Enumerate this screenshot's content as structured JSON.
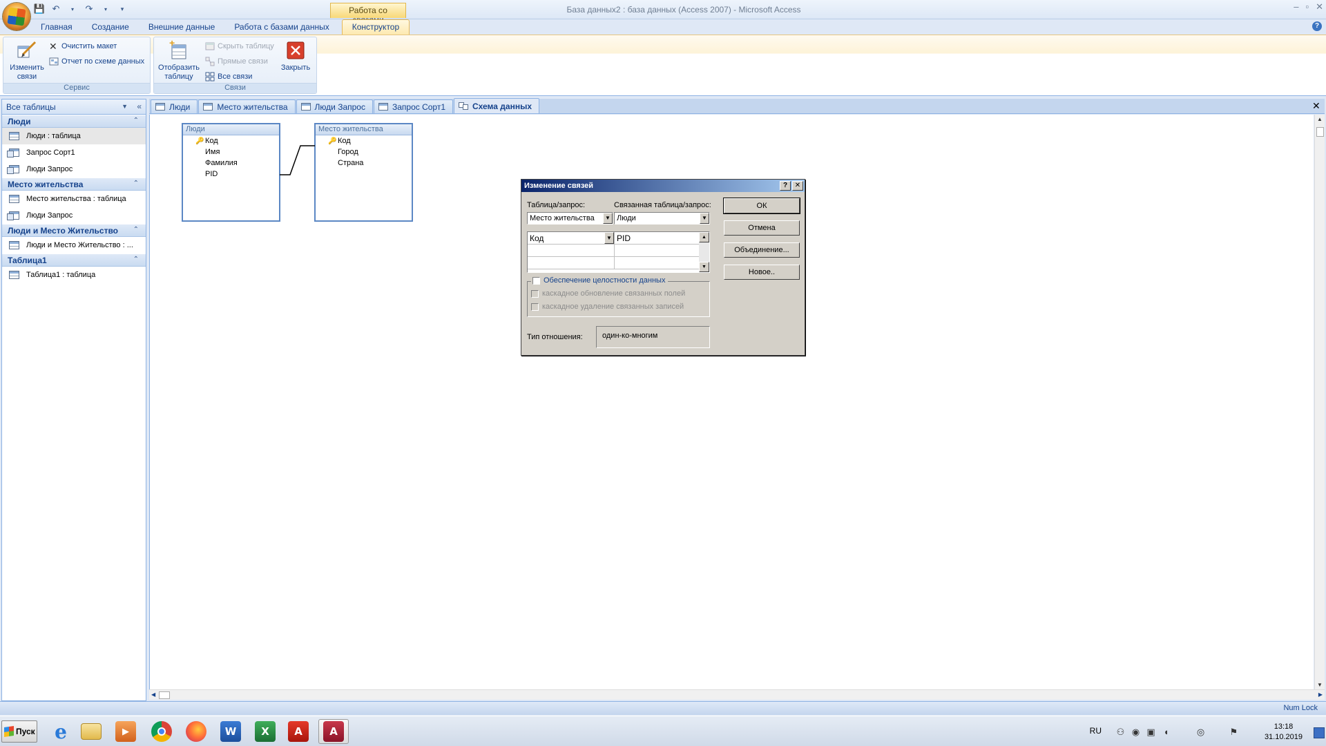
{
  "window": {
    "title": "База данных2 : база данных (Access 2007) - Microsoft Access",
    "context_tab_group": "Работа со связями"
  },
  "ribbon": {
    "tabs": [
      "Главная",
      "Создание",
      "Внешние данные",
      "Работа с базами данных",
      "Конструктор"
    ],
    "active_tab": "Конструктор",
    "groups": {
      "service": {
        "label": "Сервис",
        "edit_links": "Изменить связи",
        "clear_layout": "Очистить макет",
        "schema_report": "Отчет по схеме данных"
      },
      "links": {
        "label": "Связи",
        "show_table": "Отобразить таблицу",
        "hide_table": "Скрыть таблицу",
        "direct_links": "Прямые связи",
        "all_links": "Все связи",
        "close": "Закрыть"
      }
    }
  },
  "nav": {
    "header": "Все таблицы",
    "groups": [
      {
        "title": "Люди",
        "items": [
          {
            "label": "Люди : таблица",
            "type": "table",
            "selected": true
          },
          {
            "label": "Запрос Сорт1",
            "type": "query"
          },
          {
            "label": "Люди Запрос",
            "type": "query"
          }
        ]
      },
      {
        "title": "Место жительства",
        "items": [
          {
            "label": "Место жительства : таблица",
            "type": "table"
          },
          {
            "label": "Люди Запрос",
            "type": "query"
          }
        ]
      },
      {
        "title": "Люди и Место Жительство",
        "items": [
          {
            "label": "Люди и Место Жительство : ...",
            "type": "table"
          }
        ]
      },
      {
        "title": "Таблица1",
        "items": [
          {
            "label": "Таблица1 : таблица",
            "type": "table"
          }
        ]
      }
    ]
  },
  "doc_tabs": [
    {
      "label": "Люди",
      "icon": "table"
    },
    {
      "label": "Место жительства",
      "icon": "table"
    },
    {
      "label": "Люди Запрос",
      "icon": "query"
    },
    {
      "label": "Запрос Сорт1",
      "icon": "query"
    },
    {
      "label": "Схема данных",
      "icon": "relationships",
      "active": true
    }
  ],
  "schema": {
    "table1": {
      "title": "Люди",
      "fields": [
        "Код",
        "Имя",
        "Фамилия",
        "PID"
      ],
      "key_field": "Код"
    },
    "table2": {
      "title": "Место жительства",
      "fields": [
        "Код",
        "Город",
        "Страна"
      ],
      "key_field": "Код"
    }
  },
  "dialog": {
    "title": "Изменение связей",
    "table_label": "Таблица/запрос:",
    "related_label": "Связанная таблица/запрос:",
    "table_value": "Место жительства",
    "related_value": "Люди",
    "field_left": "Код",
    "field_right": "PID",
    "buttons": {
      "ok": "ОК",
      "cancel": "Отмена",
      "join": "Объединение...",
      "new": "Новое.."
    },
    "integrity": "Обеспечение целостности данных",
    "cascade_update": "каскадное обновление связанных полей",
    "cascade_delete": "каскадное удаление связанных записей",
    "rel_type_label": "Тип отношения:",
    "rel_type_value": "один-ко-многим"
  },
  "status": {
    "numlock": "Num Lock"
  },
  "taskbar": {
    "start": "Пуск",
    "lang": "RU",
    "time": "13:18",
    "date": "31.10.2019"
  }
}
